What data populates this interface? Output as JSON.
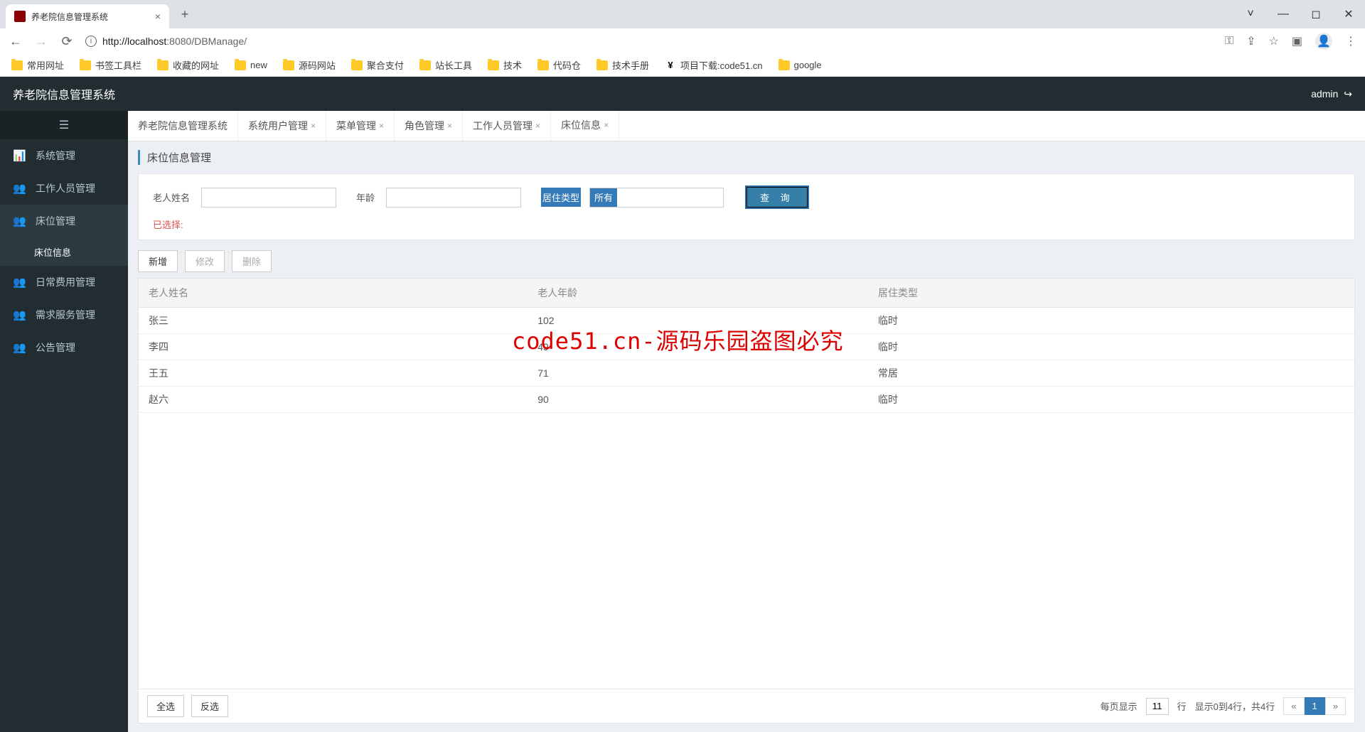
{
  "browser": {
    "tab_title": "养老院信息管理系统",
    "url_proto_host": "http://localhost",
    "url_port_path": ":8080/DBManage/",
    "bookmarks": [
      "常用网址",
      "书签工具栏",
      "收藏的网址",
      "new",
      "源码网站",
      "聚合支付",
      "站长工具",
      "技术",
      "代码仓",
      "技术手册",
      "项目下载:code51.cn",
      "google"
    ],
    "special_bookmark_index": 10
  },
  "app": {
    "title": "养老院信息管理系统",
    "user": "admin"
  },
  "sidebar": {
    "items": [
      {
        "label": "系统管理",
        "icon": "i-chart"
      },
      {
        "label": "工作人员管理",
        "icon": "i-users"
      },
      {
        "label": "床位管理",
        "icon": "i-users",
        "active": true,
        "sub": [
          {
            "label": "床位信息"
          }
        ]
      },
      {
        "label": "日常费用管理",
        "icon": "i-users"
      },
      {
        "label": "需求服务管理",
        "icon": "i-users"
      },
      {
        "label": "公告管理",
        "icon": "i-users"
      }
    ]
  },
  "tabs": [
    {
      "label": "养老院信息管理系统",
      "closable": false
    },
    {
      "label": "系统用户管理",
      "closable": true
    },
    {
      "label": "菜单管理",
      "closable": true
    },
    {
      "label": "角色管理",
      "closable": true
    },
    {
      "label": "工作人员管理",
      "closable": true
    },
    {
      "label": "床位信息",
      "closable": true,
      "active": true
    }
  ],
  "panel": {
    "title": "床位信息管理",
    "search": {
      "name_label": "老人姓名",
      "age_label": "年龄",
      "type_label": "居住类型",
      "type_value": "所有",
      "query_btn": "查 询",
      "selected_label": "已选择:"
    },
    "actions": {
      "add": "新增",
      "edit": "修改",
      "delete": "删除"
    }
  },
  "table": {
    "cols": [
      "老人姓名",
      "老人年龄",
      "居住类型"
    ],
    "rows": [
      {
        "name": "张三",
        "age": "102",
        "type": "临时"
      },
      {
        "name": "李四",
        "age": "49",
        "type": "临时"
      },
      {
        "name": "王五",
        "age": "71",
        "type": "常居"
      },
      {
        "name": "赵六",
        "age": "90",
        "type": "临时"
      }
    ]
  },
  "footer": {
    "select_all": "全选",
    "invert": "反选",
    "per_page_label": "每页显示",
    "per_page_value": "11",
    "rows_label": "行",
    "range_label": "显示0到4行，共4行",
    "page": "1"
  },
  "watermark": "code51.cn-源码乐园盗图必究"
}
